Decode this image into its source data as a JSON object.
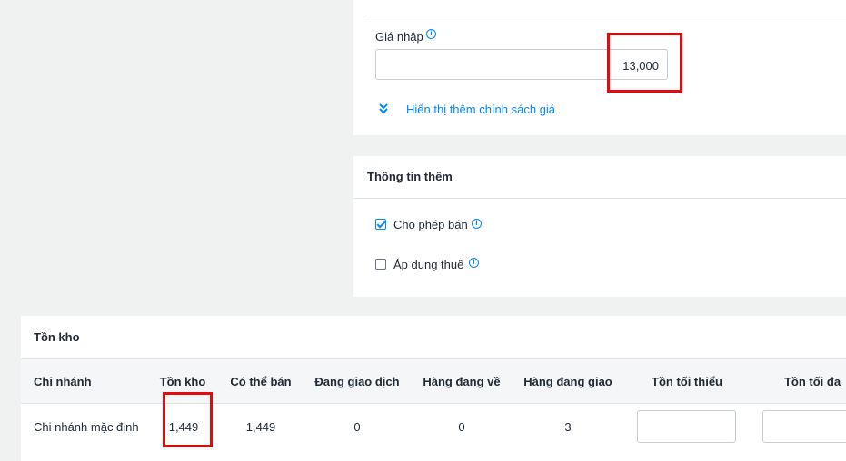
{
  "pricing": {
    "import_price_label": "Giá nhập",
    "import_price_value": "13,000",
    "show_more_label": "Hiển thị thêm chính sách giá"
  },
  "extra_info": {
    "title": "Thông tin thêm",
    "allow_sale_label": "Cho phép bán",
    "allow_sale_checked": true,
    "apply_tax_label": "Áp dụng thuế",
    "apply_tax_checked": false
  },
  "inventory": {
    "title": "Tồn kho",
    "columns": [
      "Chi nhánh",
      "Tồn kho",
      "Có thể bán",
      "Đang giao dịch",
      "Hàng đang về",
      "Hàng đang giao",
      "Tồn tối thiểu",
      "Tồn tối đa"
    ],
    "rows": [
      {
        "branch": "Chi nhánh mặc định",
        "on_hand": "1,449",
        "available": "1,449",
        "in_transaction": "0",
        "incoming": "0",
        "shipping": "3",
        "min_stock": "",
        "max_stock": ""
      }
    ]
  },
  "colors": {
    "accent": "#0088ff",
    "highlight": "#e30b0b",
    "background": "#f0f1f1"
  }
}
